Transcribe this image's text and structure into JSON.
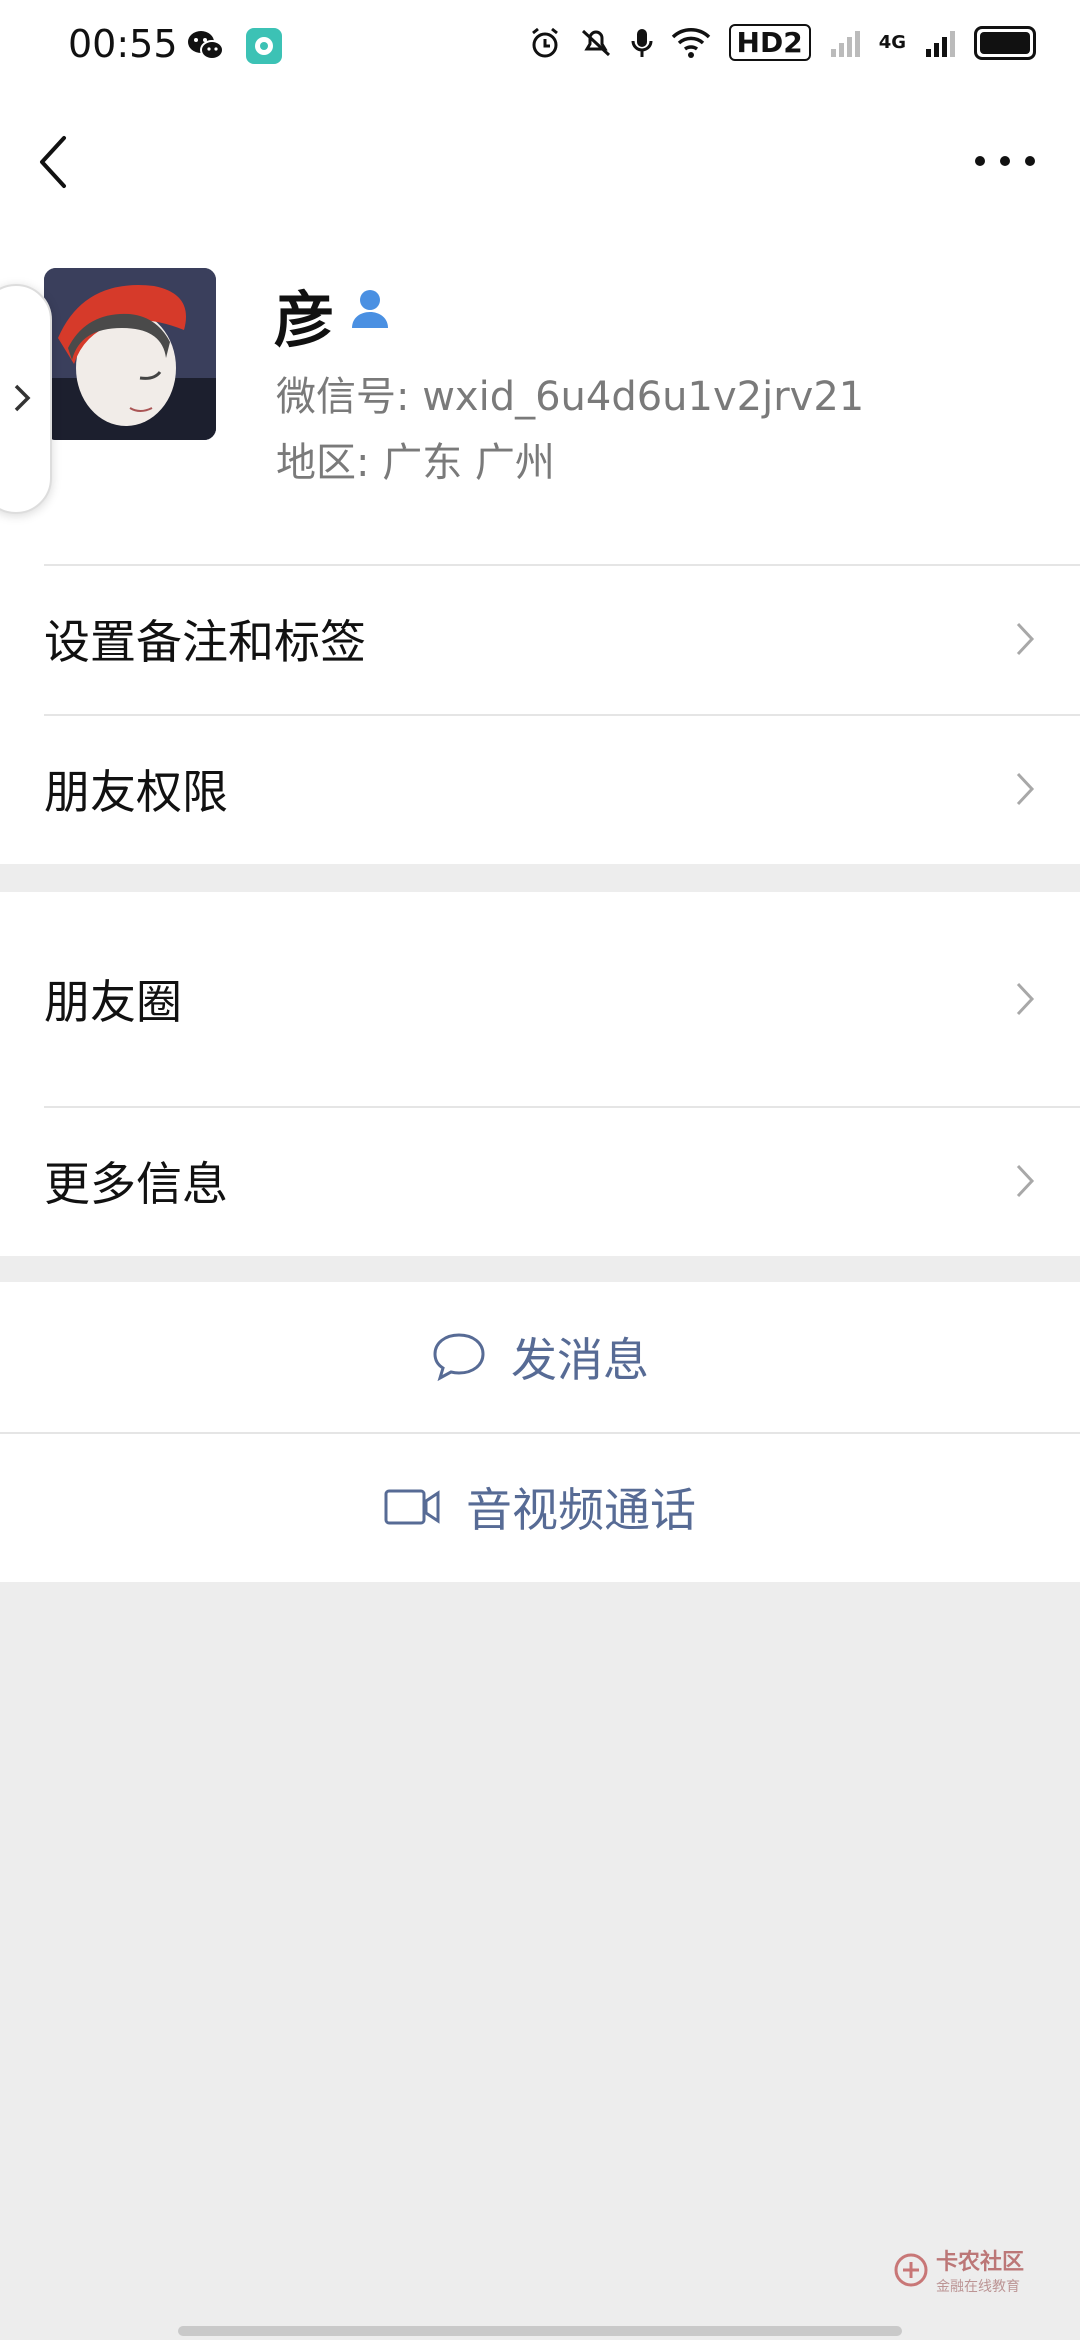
{
  "status_bar": {
    "time": "00:55",
    "icons": [
      "wechat-icon",
      "chat-app-icon",
      "alarm-icon",
      "mute-icon",
      "mic-icon",
      "wifi-icon",
      "hd-icon",
      "signal-icon",
      "4g-signal-icon",
      "battery-icon"
    ],
    "hd_label": "HD2",
    "network_label": "4G"
  },
  "profile": {
    "name": "彦",
    "wechat_id": "微信号: wxid_6u4d6u1v2jrv21",
    "region": "地区: 广东  广州"
  },
  "menu_group1": [
    {
      "label": "设置备注和标签"
    },
    {
      "label": "朋友权限"
    }
  ],
  "menu_group2": [
    {
      "label": "朋友圈"
    },
    {
      "label": "更多信息"
    }
  ],
  "actions": {
    "message": "发消息",
    "video_call": "音视频通话"
  },
  "watermark": {
    "title": "卡农社区",
    "subtitle": "金融在线教育"
  },
  "colors": {
    "accent_link": "#576b95",
    "icon_blue": "#4a90e2",
    "background": "#ededed"
  }
}
